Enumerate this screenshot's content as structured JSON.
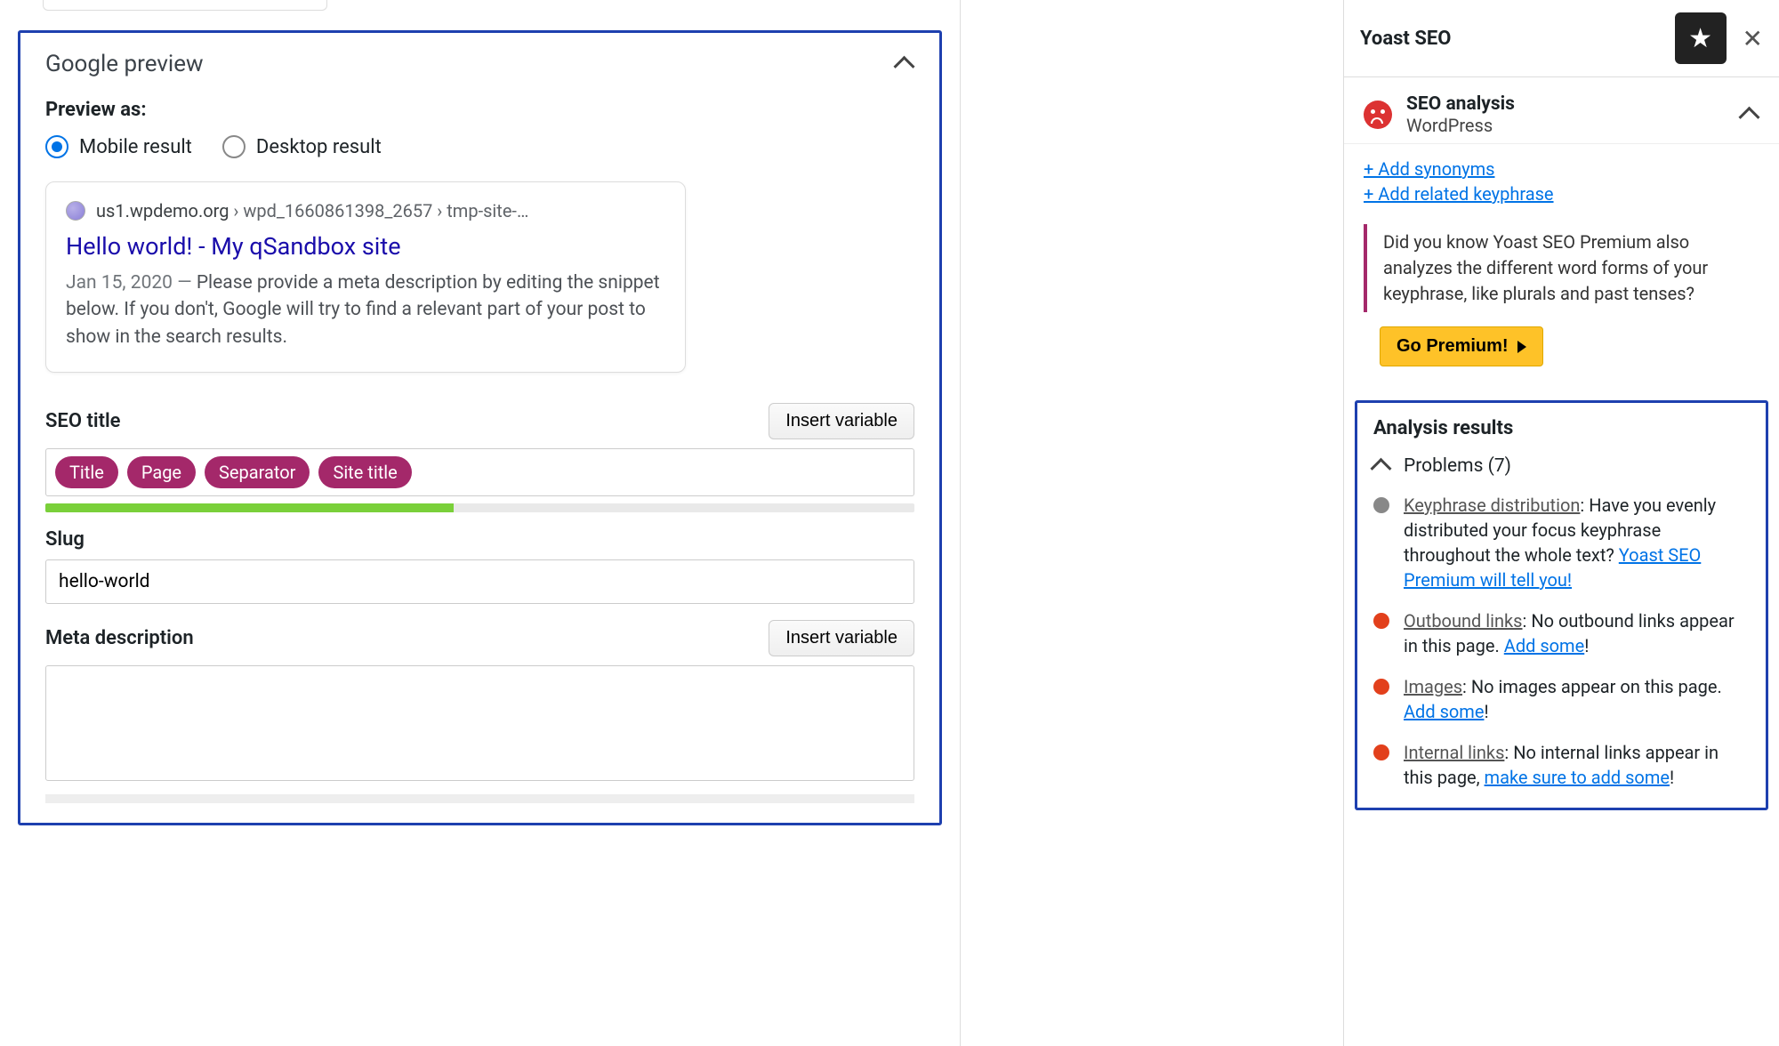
{
  "googlePreview": {
    "panelTitle": "Google preview",
    "previewAsLabel": "Preview as:",
    "radioMobile": "Mobile result",
    "radioDesktop": "Desktop result",
    "selected": "mobile",
    "snippet": {
      "domain": "us1.wpdemo.org",
      "path": " › wpd_1660861398_2657 › tmp-site-…",
      "title": "Hello world! - My qSandbox site",
      "date": "Jan 15, 2020",
      "separator": " — ",
      "description": "Please provide a meta description by editing the snippet below. If you don't, Google will try to find a relevant part of your post to show in the search results."
    },
    "fields": {
      "seoTitleLabel": "SEO title",
      "insertVariable": "Insert variable",
      "chips": [
        "Title",
        "Page",
        "Separator",
        "Site title"
      ],
      "progressPct": 47,
      "slugLabel": "Slug",
      "slugValue": "hello-world",
      "metaLabel": "Meta description",
      "metaValue": ""
    }
  },
  "sidebar": {
    "headerTitle": "Yoast SEO",
    "seoAnalysis": {
      "title": "SEO analysis",
      "keyword": "WordPress",
      "addSynonyms": "+ Add synonyms",
      "addRelated": "+ Add related keyphrase",
      "promoText": "Did you know Yoast SEO Premium also analyzes the different word forms of your keyphrase, like plurals and past tenses?",
      "goPremium": "Go Premium!"
    },
    "results": {
      "heading": "Analysis results",
      "problemsLabel": "Problems (7)",
      "items": [
        {
          "severity": "gray",
          "name": "Keyphrase distribution",
          "body1": ": Have you evenly distributed your focus keyphrase throughout the whole text? ",
          "link": "Yoast SEO Premium will tell you!",
          "body2": ""
        },
        {
          "severity": "red",
          "name": "Outbound links",
          "body1": ": No outbound links appear in this page. ",
          "link": "Add some",
          "body2": "!"
        },
        {
          "severity": "red",
          "name": "Images",
          "body1": ": No images appear on this page. ",
          "link": "Add some",
          "body2": "!"
        },
        {
          "severity": "red",
          "name": "Internal links",
          "body1": ": No internal links appear in this page, ",
          "link": "make sure to add some",
          "body2": "!"
        }
      ]
    }
  }
}
